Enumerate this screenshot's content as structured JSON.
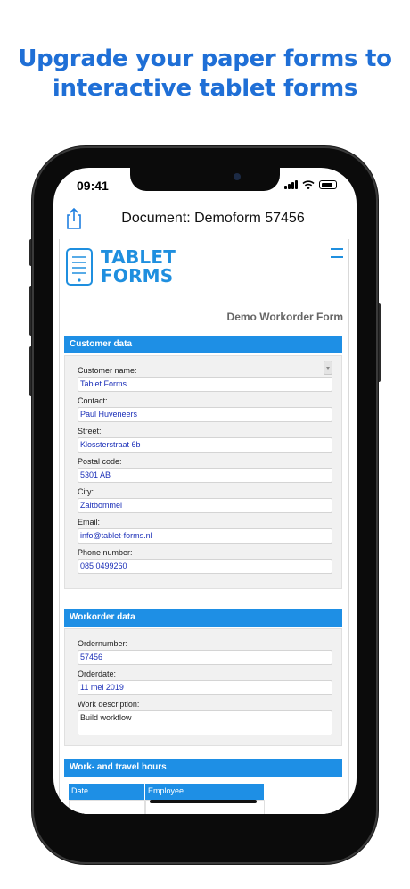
{
  "headline": {
    "line1": "Upgrade your paper forms to",
    "line2": "interactive tablet forms"
  },
  "status_bar": {
    "time": "09:41"
  },
  "nav": {
    "title": "Document: Demoform 57456",
    "share_icon": "share-icon"
  },
  "logo": {
    "line1": "TABLET",
    "line2": "FORMS"
  },
  "form_title": "Demo Workorder Form",
  "customer": {
    "title": "Customer data",
    "fields": [
      {
        "label": "Customer name:",
        "value": "Tablet Forms"
      },
      {
        "label": "Contact:",
        "value": "Paul Huveneers"
      },
      {
        "label": "Street:",
        "value": "Klossterstraat 6b"
      },
      {
        "label": "Postal code:",
        "value": "5301 AB"
      },
      {
        "label": "City:",
        "value": "Zaltbommel"
      },
      {
        "label": "Email:",
        "value": "info@tablet-forms.nl"
      },
      {
        "label": "Phone number:",
        "value": "085 0499260"
      }
    ]
  },
  "workorder": {
    "title": "Workorder data",
    "fields": [
      {
        "label": "Ordernumber:",
        "value": "57456"
      },
      {
        "label": "Orderdate:",
        "value": "11 mei 2019"
      },
      {
        "label": "Work description:",
        "value": "Build workflow"
      }
    ]
  },
  "hours": {
    "title": "Work- and travel hours",
    "columns": [
      "Date",
      "Employee"
    ]
  },
  "colors": {
    "accent": "#1e8fe5",
    "headline": "#1f6fd6",
    "value_text": "#1b2fb8"
  }
}
